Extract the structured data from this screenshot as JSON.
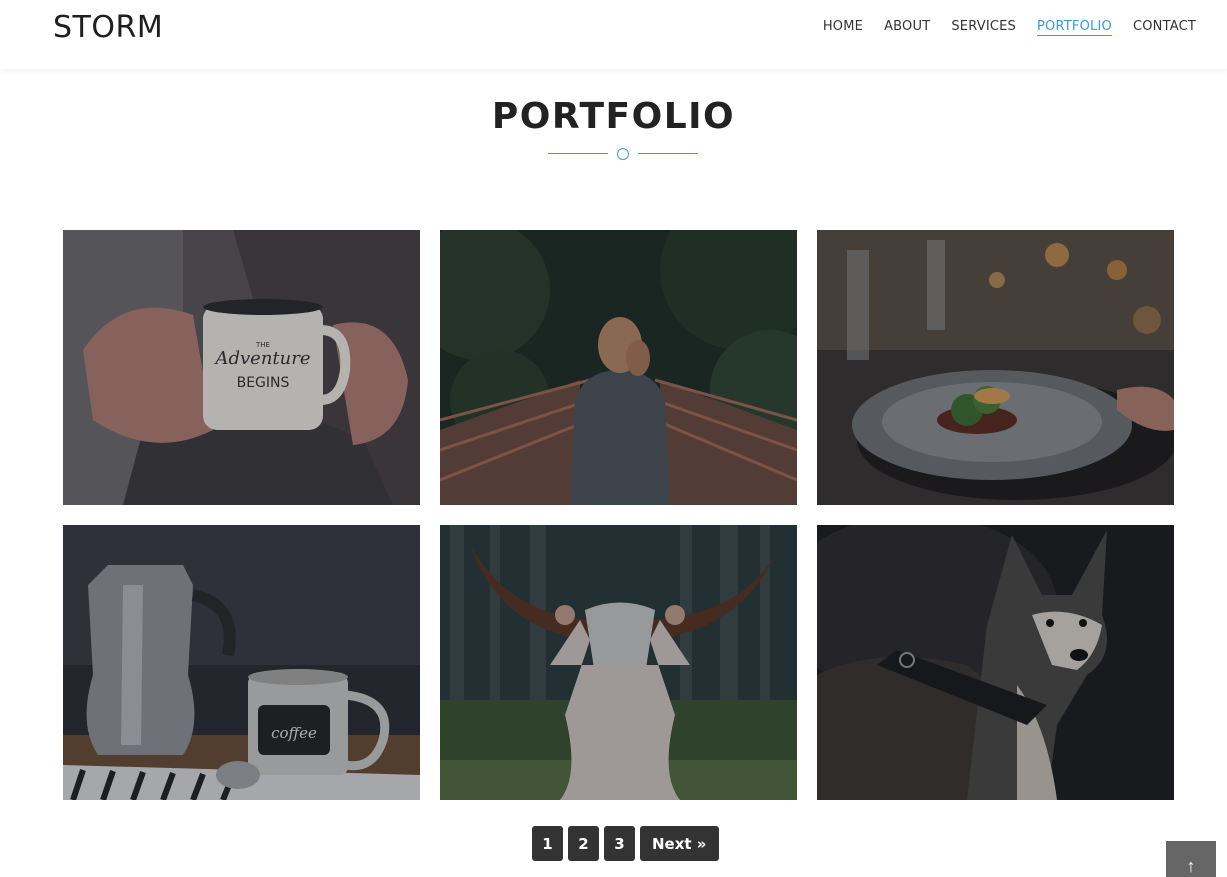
{
  "header": {
    "logo": "STORM",
    "nav": [
      {
        "label": "HOME",
        "active": false
      },
      {
        "label": "ABOUT",
        "active": false
      },
      {
        "label": "SERVICES",
        "active": false
      },
      {
        "label": "PORTFOLIO",
        "active": true
      },
      {
        "label": "CONTACT",
        "active": false
      }
    ]
  },
  "section": {
    "title": "PORTFOLIO",
    "accent_color": "#3a9bd5"
  },
  "portfolio": {
    "items": [
      {
        "subject": "hands holding enamel mug",
        "mug_text_1": "THE",
        "mug_text_2": "Adventure",
        "mug_text_3": "BEGINS"
      },
      {
        "subject": "woman on wooden bridge in forest"
      },
      {
        "subject": "plated dish at restaurant table"
      },
      {
        "subject": "moka pot and coffee mug",
        "mug_text": "coffee"
      },
      {
        "subject": "woman holding cow skull with horns"
      },
      {
        "subject": "husky dog with harness"
      }
    ]
  },
  "pagination": {
    "pages": [
      "1",
      "2",
      "3"
    ],
    "next_label": "Next »"
  },
  "back_to_top": {
    "icon": "arrow-up-icon",
    "label": "↑"
  }
}
